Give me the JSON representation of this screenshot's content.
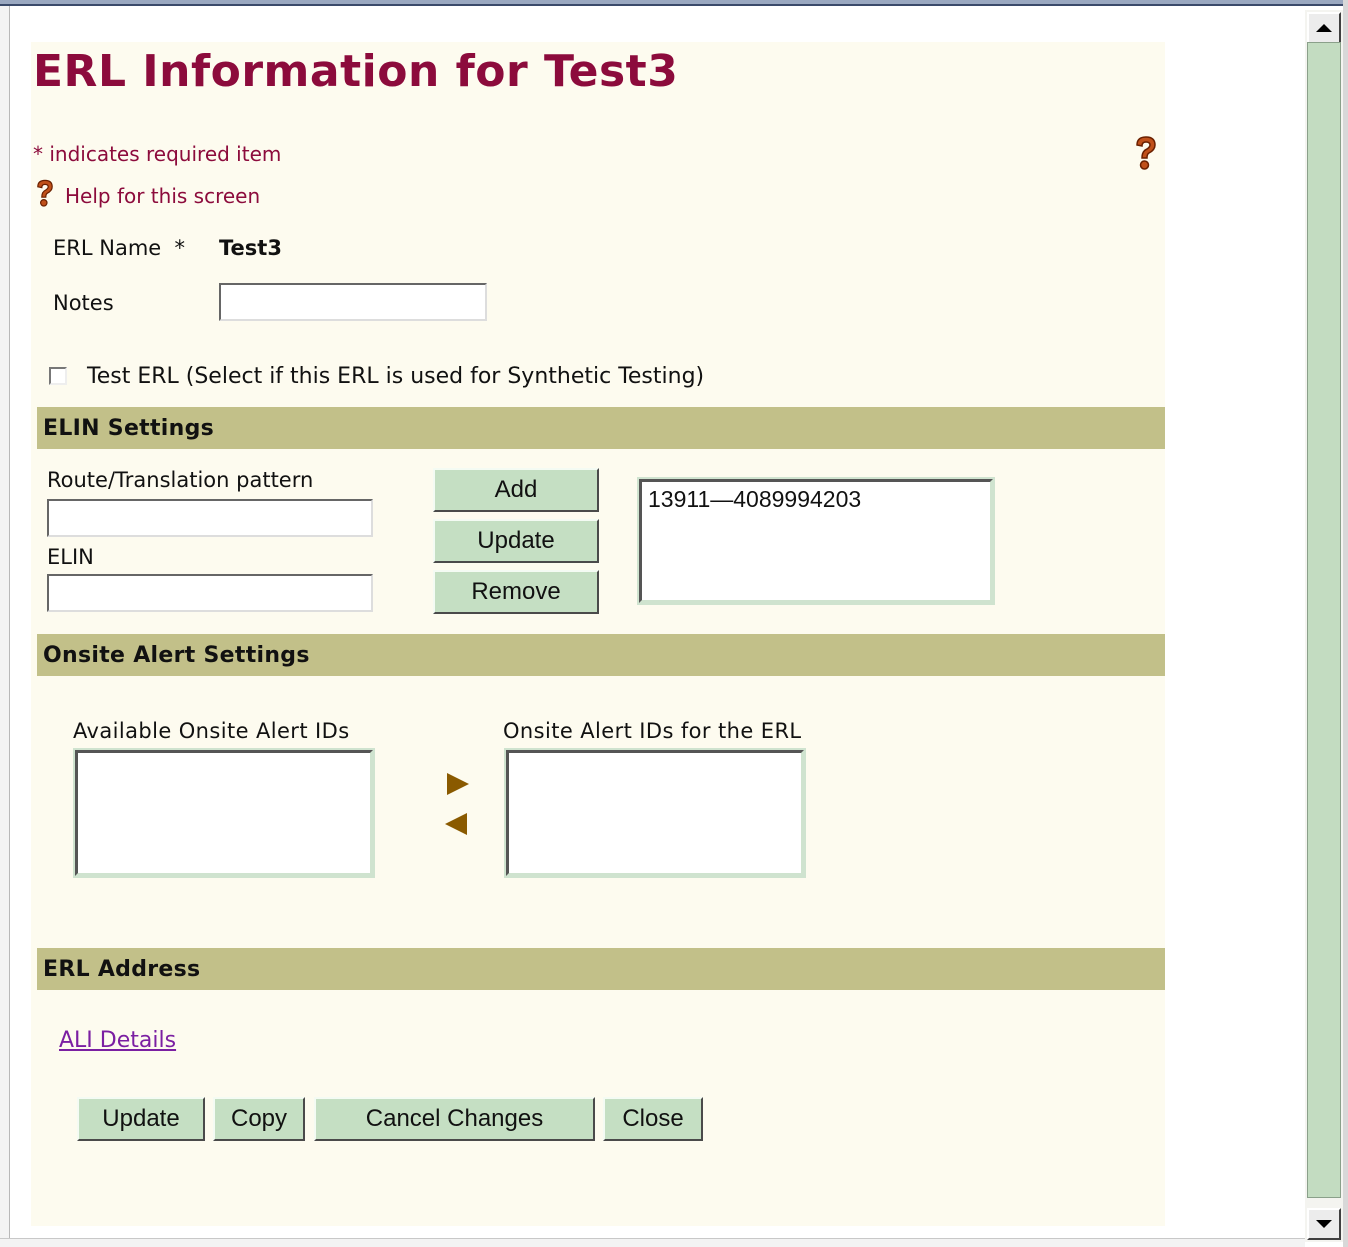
{
  "page": {
    "title": "ERL Information for Test3",
    "required_note": "* indicates required item",
    "help_link": "Help for this screen"
  },
  "form": {
    "erl_name_label": "ERL Name  *",
    "erl_name_value": "Test3",
    "notes_label": "Notes",
    "notes_value": "",
    "test_erl_label": "Test ERL (Select if this ERL is used for Synthetic Testing)",
    "test_erl_checked": false
  },
  "elin_settings": {
    "header": "ELIN Settings",
    "route_label": "Route/Translation pattern",
    "route_value": "",
    "elin_label": "ELIN",
    "elin_value": "",
    "buttons": {
      "add": "Add",
      "update": "Update",
      "remove": "Remove"
    },
    "list_items": [
      "13911—4089994203"
    ]
  },
  "onsite_alert_settings": {
    "header": "Onsite Alert Settings",
    "available_label": "Available Onsite Alert IDs",
    "selected_label": "Onsite Alert IDs for the ERL",
    "available_items": [],
    "selected_items": []
  },
  "erl_address": {
    "header": "ERL Address",
    "ali_link": "ALI Details"
  },
  "actions": {
    "update": "Update",
    "copy": "Copy",
    "cancel": "Cancel Changes",
    "close": "Close"
  },
  "colors": {
    "title": "#8c0b3c",
    "section_header_bg": "#c2c089",
    "page_bg": "#fdfbef",
    "button_bg": "#c5dfc3",
    "link": "#7b1fa2"
  },
  "icons": {
    "help_top_right": "help-question-icon",
    "help_inline": "help-question-icon",
    "move_right": "arrow-right-icon",
    "move_left": "arrow-left-icon"
  }
}
